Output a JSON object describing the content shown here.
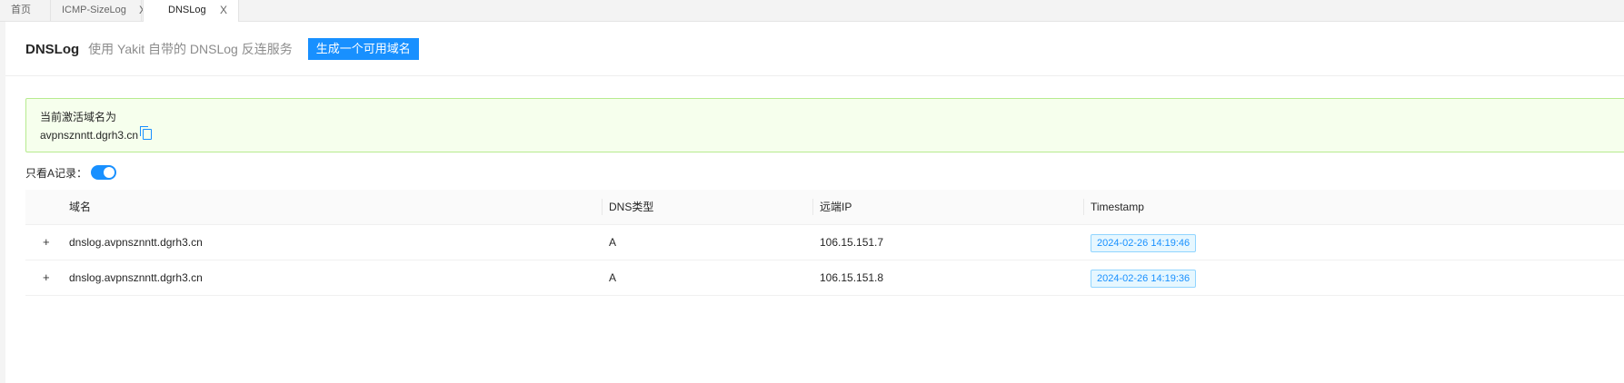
{
  "tabs": [
    {
      "label": "首页",
      "closable": false,
      "active": false
    },
    {
      "label": "ICMP-SizeLog",
      "closable": true,
      "active": false
    },
    {
      "label": "DNSLog",
      "closable": true,
      "active": true
    }
  ],
  "close_glyph": "X",
  "header": {
    "title": "DNSLog",
    "subtitle": "使用 Yakit 自带的 DNSLog 反连服务",
    "generate_button": "生成一个可用域名"
  },
  "alert": {
    "label": "当前激活域名为",
    "domain": "avpnsznntt.dgrh3.cn",
    "icon": "copy-icon"
  },
  "filter": {
    "label": "只看A记录：",
    "enabled": true
  },
  "table": {
    "columns": [
      "域名",
      "DNS类型",
      "远端IP",
      "Timestamp"
    ],
    "rows": [
      {
        "domain": "dnslog.avpnsznntt.dgrh3.cn",
        "type": "A",
        "ip": "106.15.151.7",
        "timestamp": "2024-02-26 14:19:46"
      },
      {
        "domain": "dnslog.avpnsznntt.dgrh3.cn",
        "type": "A",
        "ip": "106.15.151.8",
        "timestamp": "2024-02-26 14:19:36"
      }
    ],
    "expand_glyph": "+"
  },
  "colors": {
    "primary": "#1890ff",
    "alert_bg": "#f6ffed",
    "alert_border": "#b7eb8f"
  }
}
